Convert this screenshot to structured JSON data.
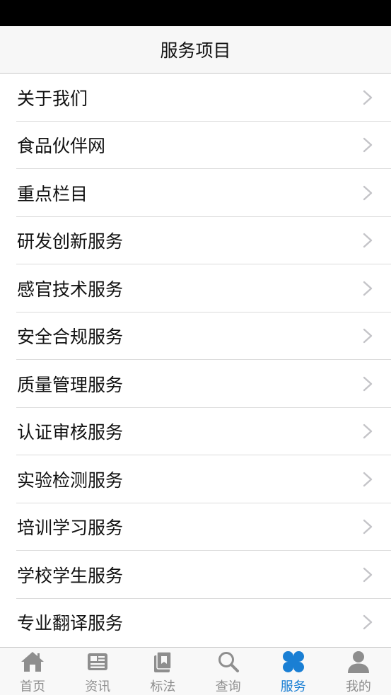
{
  "header": {
    "title": "服务项目"
  },
  "list": {
    "items": [
      {
        "label": "关于我们"
      },
      {
        "label": "食品伙伴网"
      },
      {
        "label": "重点栏目"
      },
      {
        "label": "研发创新服务"
      },
      {
        "label": "感官技术服务"
      },
      {
        "label": "安全合规服务"
      },
      {
        "label": "质量管理服务"
      },
      {
        "label": "认证审核服务"
      },
      {
        "label": "实验检测服务"
      },
      {
        "label": "培训学习服务"
      },
      {
        "label": "学校学生服务"
      },
      {
        "label": "专业翻译服务"
      }
    ]
  },
  "tabbar": {
    "tabs": [
      {
        "label": "首页",
        "icon": "home-icon",
        "active": false
      },
      {
        "label": "资讯",
        "icon": "news-icon",
        "active": false
      },
      {
        "label": "标法",
        "icon": "standards-icon",
        "active": false
      },
      {
        "label": "查询",
        "icon": "search-icon",
        "active": false
      },
      {
        "label": "服务",
        "icon": "services-icon",
        "active": true
      },
      {
        "label": "我的",
        "icon": "profile-icon",
        "active": false
      }
    ],
    "colors": {
      "active": "#1a7fd4",
      "inactive": "#8e8e8e"
    }
  }
}
